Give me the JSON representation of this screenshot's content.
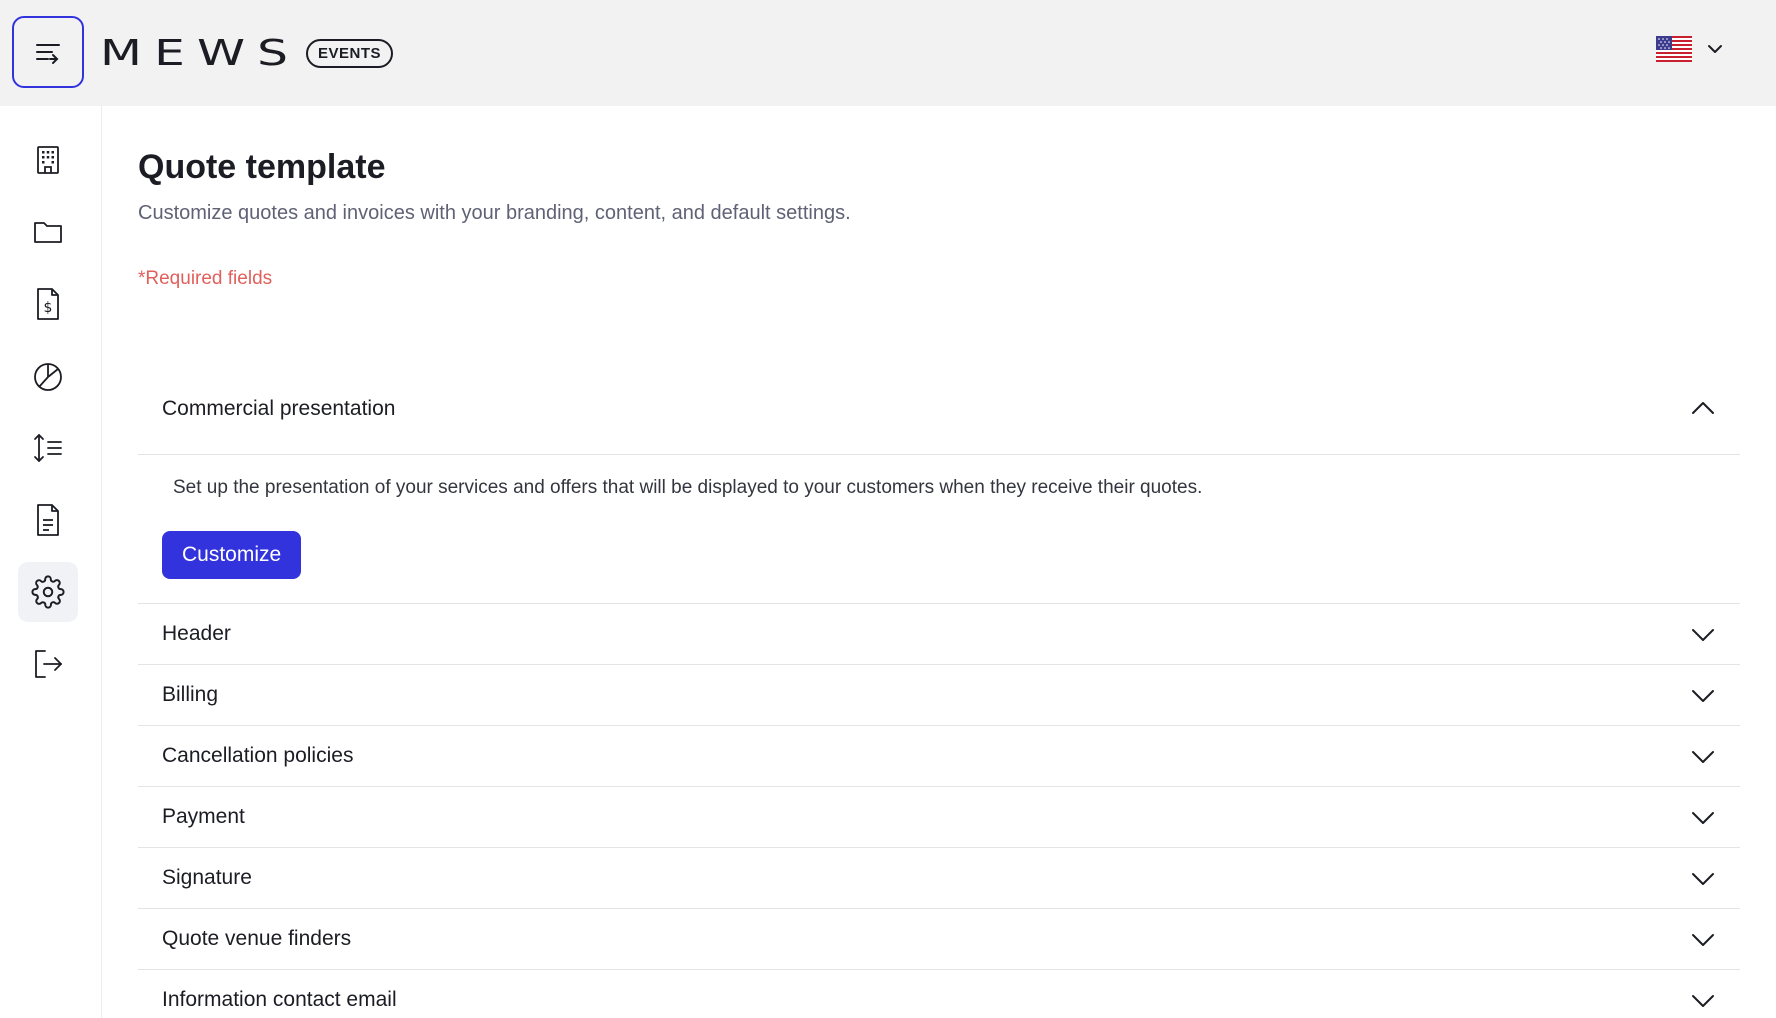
{
  "header": {
    "brand": "MEWS",
    "badge": "EVENTS",
    "language_flag": "us-flag-icon",
    "colors": {
      "topbar_bg": "#f2f2f2",
      "accent": "#3333dd"
    }
  },
  "sidebar": {
    "items": [
      {
        "id": "property",
        "icon": "building-icon",
        "active": false
      },
      {
        "id": "folders",
        "icon": "folder-icon",
        "active": false
      },
      {
        "id": "invoices",
        "icon": "invoice-dollar-icon",
        "active": false
      },
      {
        "id": "reports",
        "icon": "pie-chart-icon",
        "active": false
      },
      {
        "id": "sorting",
        "icon": "sort-list-icon",
        "active": false
      },
      {
        "id": "documents",
        "icon": "document-icon",
        "active": false
      },
      {
        "id": "settings",
        "icon": "gear-icon",
        "active": true
      },
      {
        "id": "logout",
        "icon": "logout-icon",
        "active": false
      }
    ]
  },
  "page": {
    "title": "Quote template",
    "subtitle": "Customize quotes and invoices with your branding, content, and default settings.",
    "required_note": "*Required fields"
  },
  "accordion": {
    "sections": [
      {
        "label": "Commercial presentation",
        "expanded": true,
        "description": "Set up the presentation of your services and offers that will be displayed to your customers when they receive their quotes.",
        "button_label": "Customize"
      },
      {
        "label": "Header",
        "expanded": false
      },
      {
        "label": "Billing",
        "expanded": false
      },
      {
        "label": "Cancellation policies",
        "expanded": false
      },
      {
        "label": "Payment",
        "expanded": false
      },
      {
        "label": "Signature",
        "expanded": false
      },
      {
        "label": "Quote venue finders",
        "expanded": false
      },
      {
        "label": "Information contact email",
        "expanded": false
      }
    ]
  }
}
